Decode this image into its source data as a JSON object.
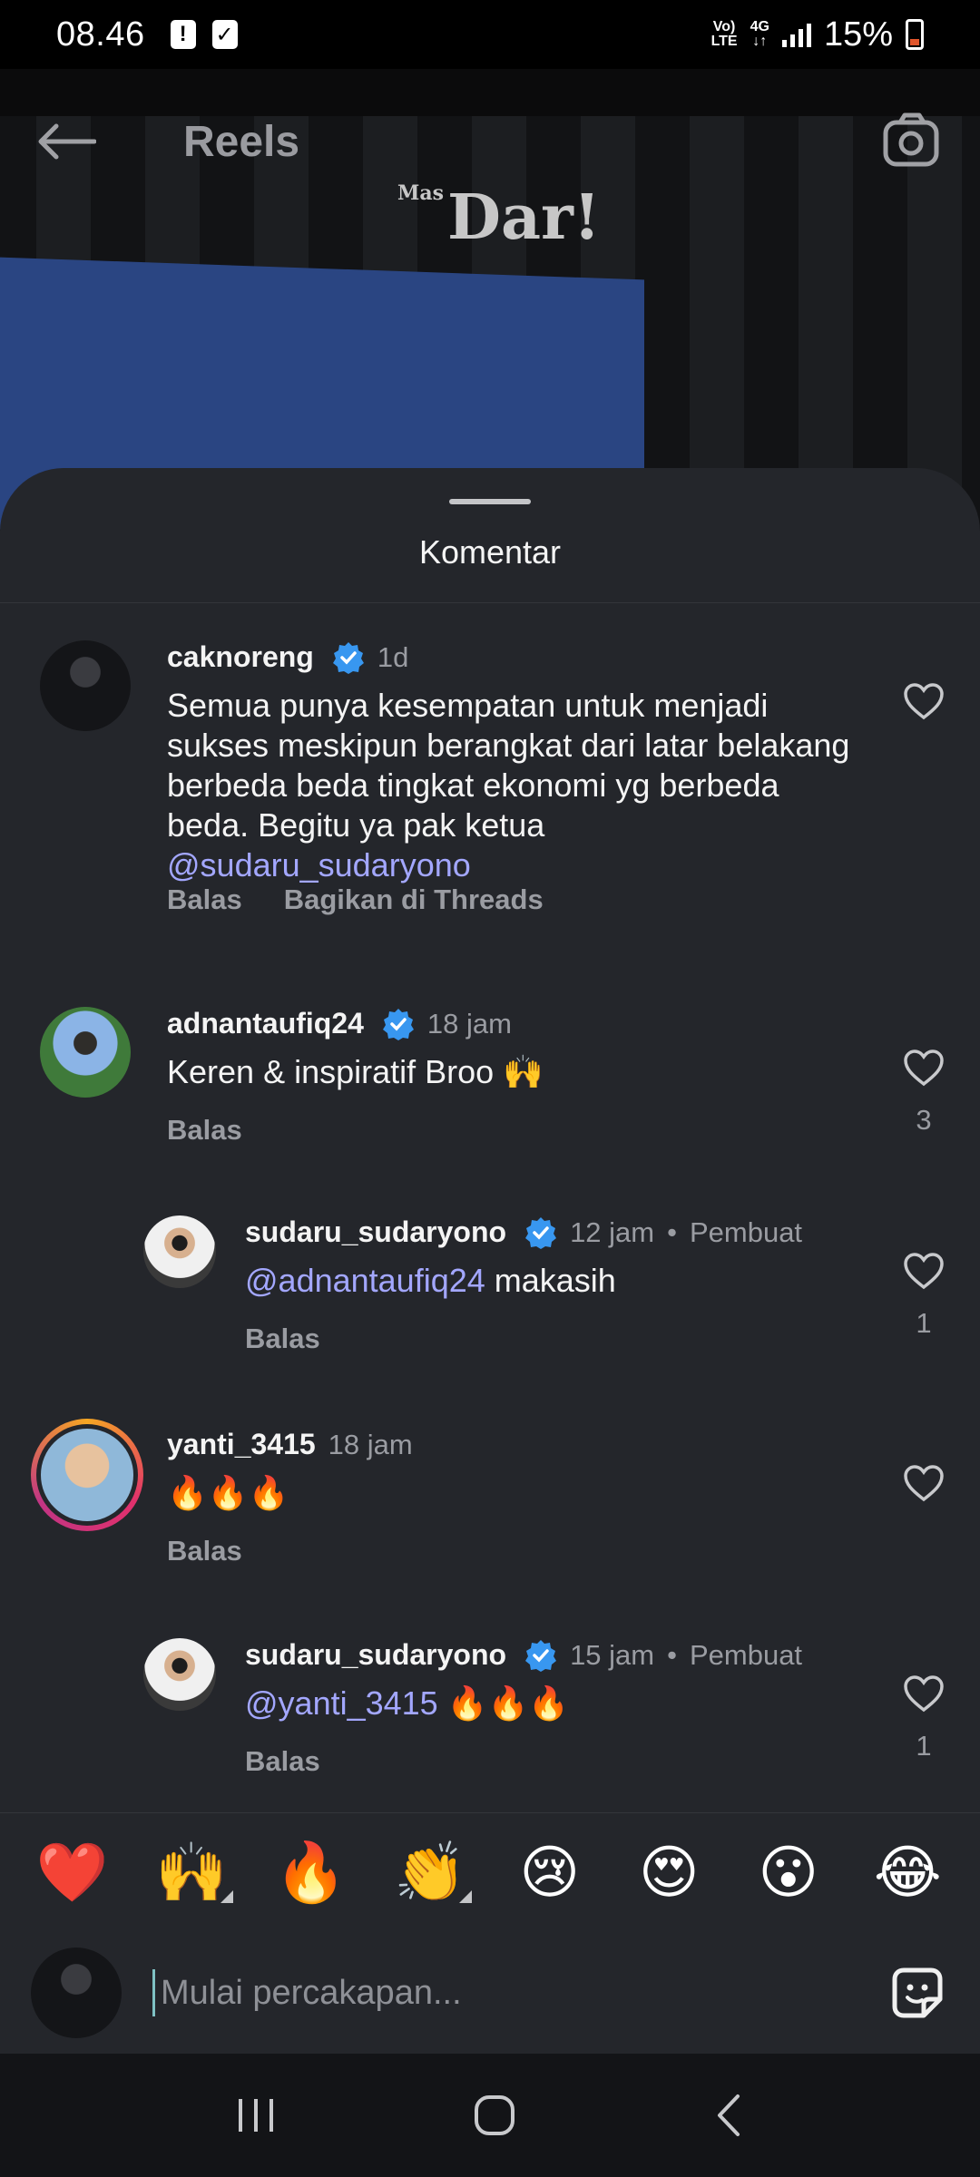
{
  "status_bar": {
    "time": "08.46",
    "network_top": "Vo)",
    "network_bottom": "LTE",
    "gen_top": "4G",
    "gen_bottom": "↓↑",
    "battery": "15%"
  },
  "reels": {
    "title": "Reels",
    "logo_small": "Mas",
    "logo": "Dar!"
  },
  "sheet": {
    "title": "Komentar"
  },
  "comments": [
    {
      "username": "caknoreng",
      "time": "1d",
      "text": "Semua punya kesempatan untuk menjadi sukses meskipun berangkat dari latar belakang berbeda beda tingkat ekonomi yg berbeda beda. Begitu ya pak ketua",
      "mention": "@sudaru_sudaryono",
      "reply_label": "Balas",
      "share_label": "Bagikan di Threads"
    },
    {
      "username": "adnantaufiq24",
      "time": "18 jam",
      "text": "Keren & inspiratif Broo 🙌",
      "reply_label": "Balas",
      "likes": "3"
    },
    {
      "username": "sudaru_sudaryono",
      "time": "12 jam",
      "creator_label": "Pembuat",
      "mention": "@adnantaufiq24",
      "text": " makasih",
      "reply_label": "Balas",
      "likes": "1"
    },
    {
      "username": "yanti_3415",
      "time": "18 jam",
      "text": "🔥🔥🔥",
      "reply_label": "Balas"
    },
    {
      "username": "sudaru_sudaryono",
      "time": "15 jam",
      "creator_label": "Pembuat",
      "mention": "@yanti_3415",
      "text": " 🔥🔥🔥",
      "reply_label": "Balas",
      "likes": "1"
    }
  ],
  "emoji_bar": [
    "❤️",
    "🙌",
    "🔥",
    "👏",
    "😢",
    "😍",
    "😮",
    "😂"
  ],
  "composer": {
    "placeholder": "Mulai percakapan..."
  },
  "colors": {
    "sheet_bg": "#24262b",
    "mention": "#a3a7ff",
    "verified": "#3897f0"
  }
}
